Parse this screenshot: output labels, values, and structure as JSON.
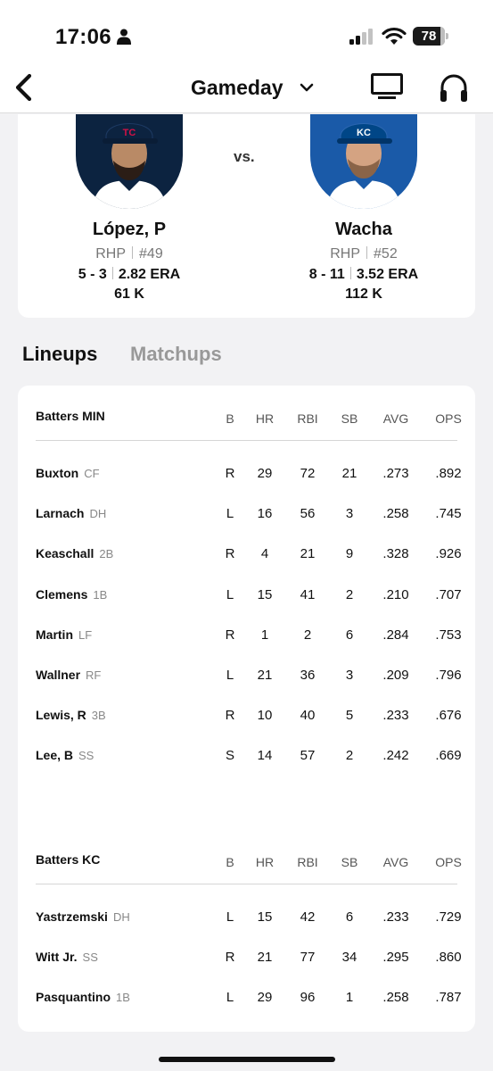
{
  "status_bar": {
    "time": "17:06",
    "battery": "78"
  },
  "nav": {
    "title": "Gameday"
  },
  "pitchers": {
    "vs": "vs.",
    "away": {
      "name": "López, P",
      "throws": "RHP",
      "number": "#49",
      "record": "5 - 3",
      "era": "2.82 ERA",
      "strikeouts": "61 K"
    },
    "home": {
      "name": "Wacha",
      "throws": "RHP",
      "number": "#52",
      "record": "8 - 11",
      "era": "3.52 ERA",
      "strikeouts": "112 K"
    }
  },
  "tabs": [
    "Lineups",
    "Matchups"
  ],
  "columns": [
    "B",
    "HR",
    "RBI",
    "SB",
    "AVG",
    "OPS"
  ],
  "lineups": [
    {
      "title": "Batters MIN",
      "rows": [
        {
          "name": "Buxton",
          "pos": "CF",
          "b": "R",
          "hr": "29",
          "rbi": "72",
          "sb": "21",
          "avg": ".273",
          "ops": ".892"
        },
        {
          "name": "Larnach",
          "pos": "DH",
          "b": "L",
          "hr": "16",
          "rbi": "56",
          "sb": "3",
          "avg": ".258",
          "ops": ".745"
        },
        {
          "name": "Keaschall",
          "pos": "2B",
          "b": "R",
          "hr": "4",
          "rbi": "21",
          "sb": "9",
          "avg": ".328",
          "ops": ".926"
        },
        {
          "name": "Clemens",
          "pos": "1B",
          "b": "L",
          "hr": "15",
          "rbi": "41",
          "sb": "2",
          "avg": ".210",
          "ops": ".707"
        },
        {
          "name": "Martin",
          "pos": "LF",
          "b": "R",
          "hr": "1",
          "rbi": "2",
          "sb": "6",
          "avg": ".284",
          "ops": ".753"
        },
        {
          "name": "Wallner",
          "pos": "RF",
          "b": "L",
          "hr": "21",
          "rbi": "36",
          "sb": "3",
          "avg": ".209",
          "ops": ".796"
        },
        {
          "name": "Lewis, R",
          "pos": "3B",
          "b": "R",
          "hr": "10",
          "rbi": "40",
          "sb": "5",
          "avg": ".233",
          "ops": ".676"
        },
        {
          "name": "Lee, B",
          "pos": "SS",
          "b": "S",
          "hr": "14",
          "rbi": "57",
          "sb": "2",
          "avg": ".242",
          "ops": ".669"
        }
      ]
    },
    {
      "title": "Batters KC",
      "rows": [
        {
          "name": "Yastrzemski",
          "pos": "DH",
          "b": "L",
          "hr": "15",
          "rbi": "42",
          "sb": "6",
          "avg": ".233",
          "ops": ".729"
        },
        {
          "name": "Witt Jr.",
          "pos": "SS",
          "b": "R",
          "hr": "21",
          "rbi": "77",
          "sb": "34",
          "avg": ".295",
          "ops": ".860"
        },
        {
          "name": "Pasquantino",
          "pos": "1B",
          "b": "L",
          "hr": "29",
          "rbi": "96",
          "sb": "1",
          "avg": ".258",
          "ops": ".787"
        }
      ]
    }
  ],
  "colors": {
    "twins_navy": "#0c2340",
    "twins_red": "#d31145",
    "royals_blue": "#004687",
    "royals_light": "#1a5aa8"
  }
}
